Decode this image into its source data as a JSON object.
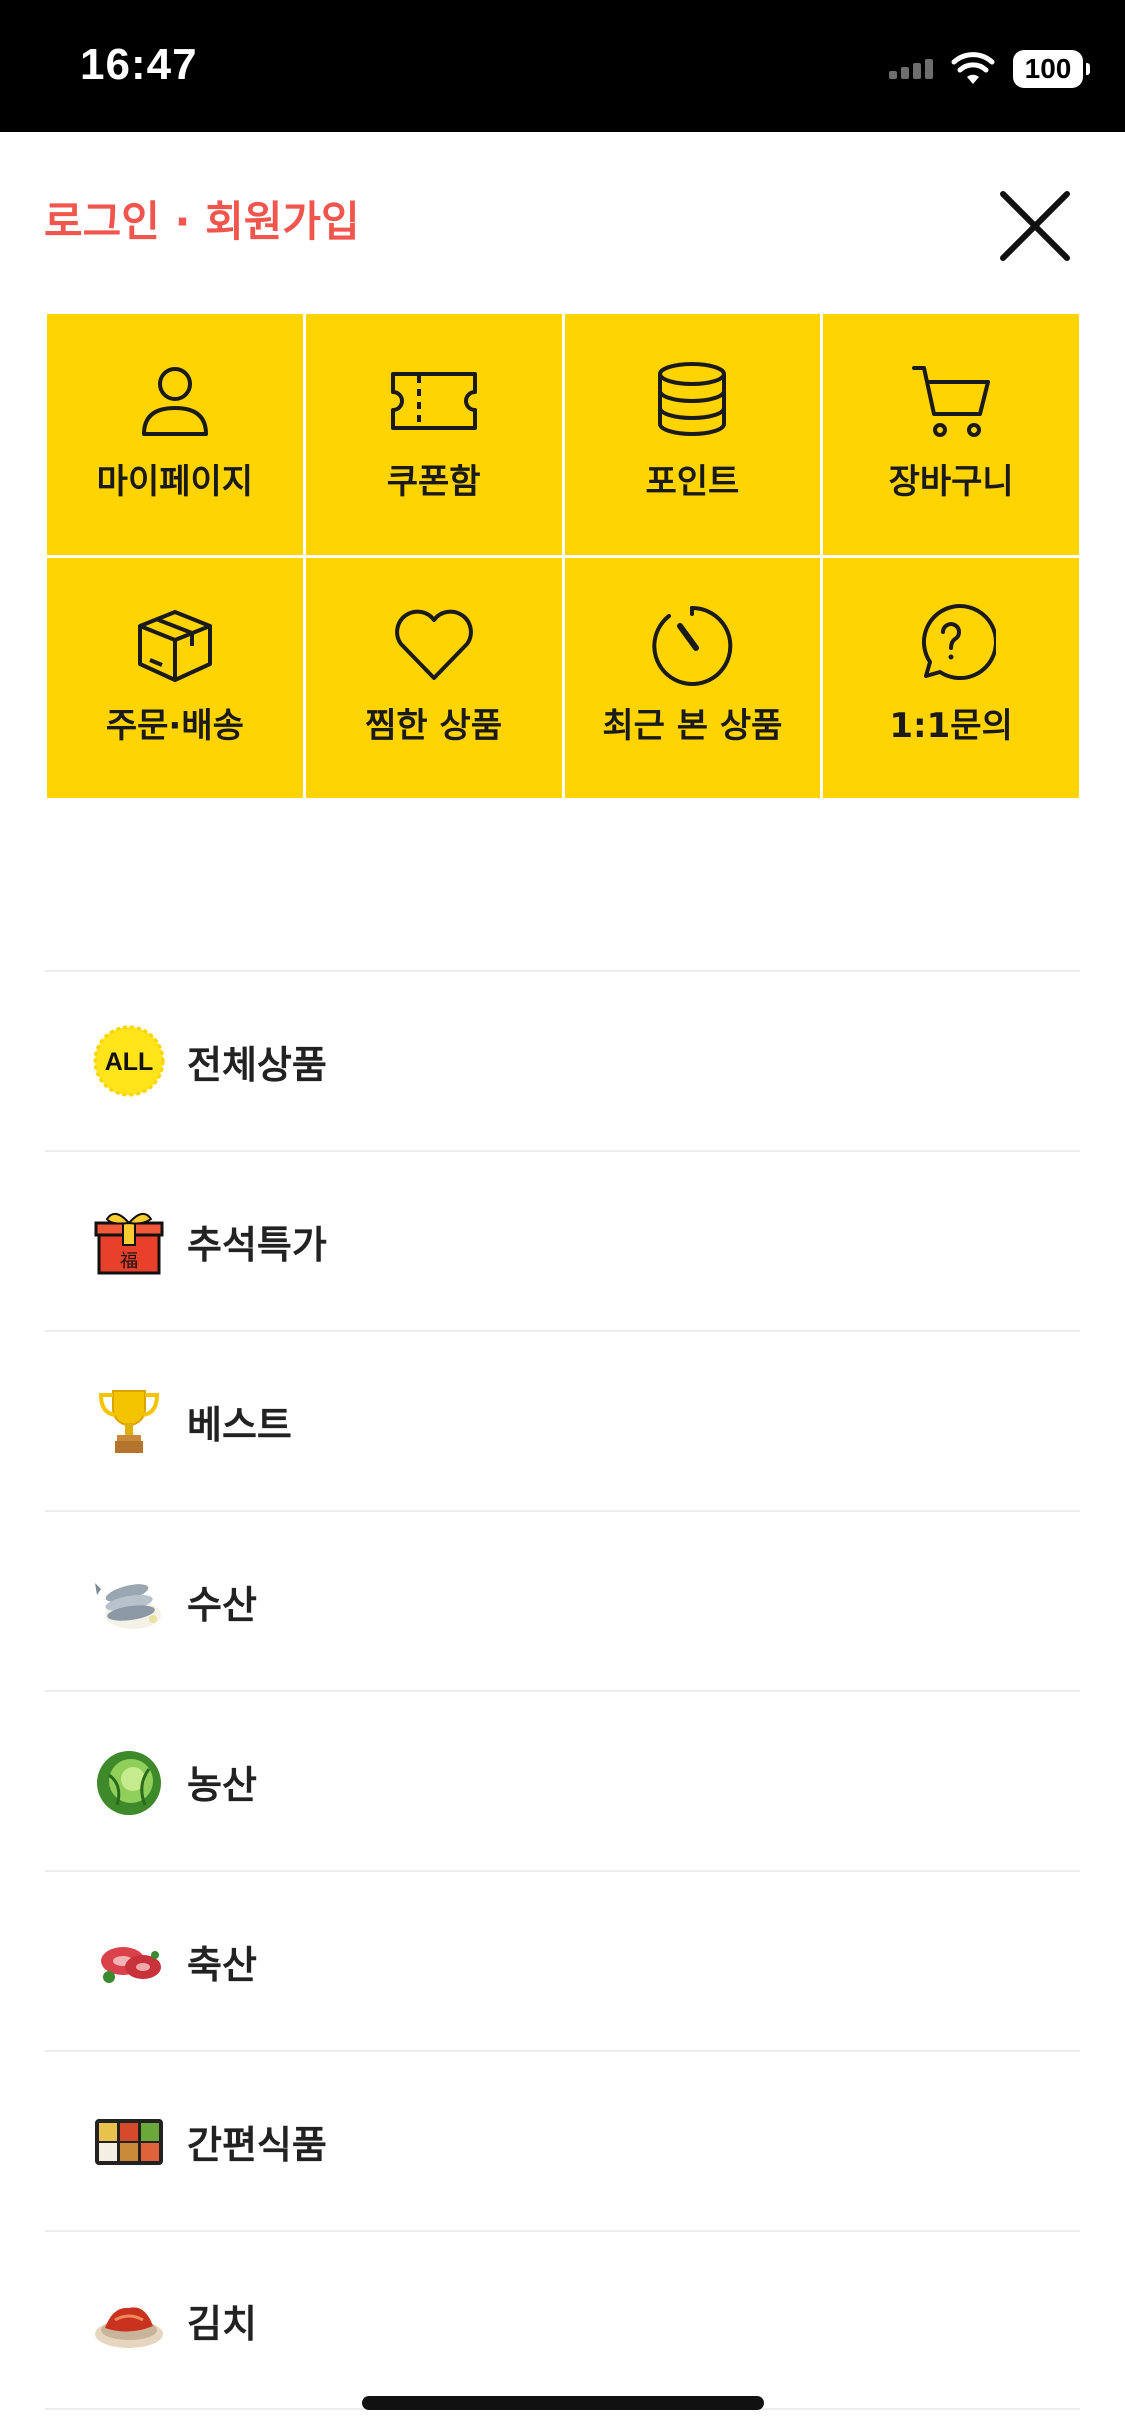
{
  "status_bar": {
    "time": "16:47",
    "battery": "100"
  },
  "header": {
    "login_link": "로그인 · 회원가입",
    "close_icon": "close-icon"
  },
  "quick_menu": [
    {
      "label": "마이페이지",
      "icon": "person-icon"
    },
    {
      "label": "쿠폰함",
      "icon": "ticket-icon"
    },
    {
      "label": "포인트",
      "icon": "coins-icon"
    },
    {
      "label": "장바구니",
      "icon": "cart-icon"
    },
    {
      "label": "주문·배송",
      "icon": "box-icon"
    },
    {
      "label": "찜한 상품",
      "icon": "heart-icon"
    },
    {
      "label": "최근 본 상품",
      "icon": "clock-icon"
    },
    {
      "label": "1:1문의",
      "icon": "question-bubble-icon"
    }
  ],
  "categories": [
    {
      "label": "전체상품",
      "icon": "all-badge-icon",
      "icon_text": "ALL"
    },
    {
      "label": "추석특가",
      "icon": "gift-box-icon",
      "icon_text": "福"
    },
    {
      "label": "베스트",
      "icon": "trophy-icon"
    },
    {
      "label": "수산",
      "icon": "fish-icon"
    },
    {
      "label": "농산",
      "icon": "cabbage-icon"
    },
    {
      "label": "축산",
      "icon": "meat-icon"
    },
    {
      "label": "간편식품",
      "icon": "lunchbox-icon"
    },
    {
      "label": "김치",
      "icon": "kimchi-icon"
    }
  ],
  "colors": {
    "accent_yellow": "#ffd400",
    "login_red": "#f0554e",
    "status_bar": "#000000"
  }
}
